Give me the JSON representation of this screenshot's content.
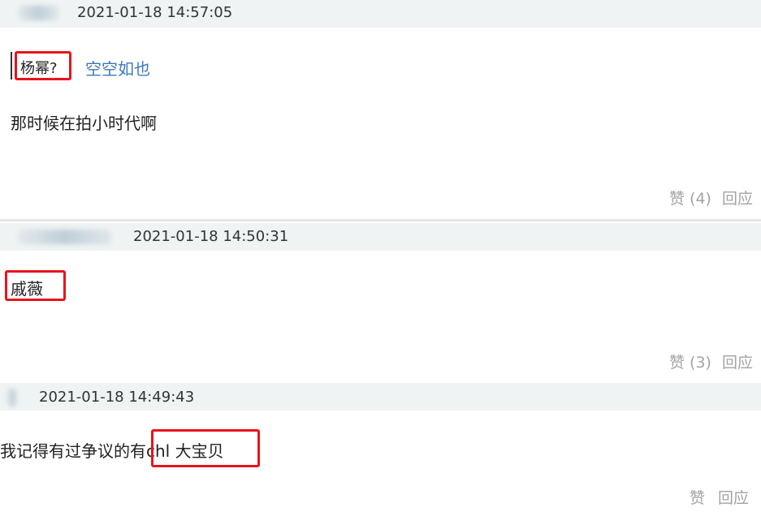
{
  "comments": [
    {
      "timestamp": "2021-01-18 14:57:05",
      "quote": {
        "text": "杨幂?",
        "author": "空空如也"
      },
      "text": "那时候在拍小时代啊",
      "like_label": "赞 (4)",
      "reply_label": "回应"
    },
    {
      "timestamp": "2021-01-18 14:50:31",
      "text": "戚薇",
      "like_label": "赞 (3)",
      "reply_label": "回应"
    },
    {
      "timestamp": "2021-01-18 14:49:43",
      "text_prefix": "我记得有过争议的有",
      "text_highlight": "chl 大宝贝",
      "like_label": "赞",
      "reply_label": "回应"
    }
  ],
  "colors": {
    "meta_bar": "#eff3f3",
    "highlight": "#e8141c",
    "link": "#3b78b8",
    "action": "#a3a3a3"
  }
}
